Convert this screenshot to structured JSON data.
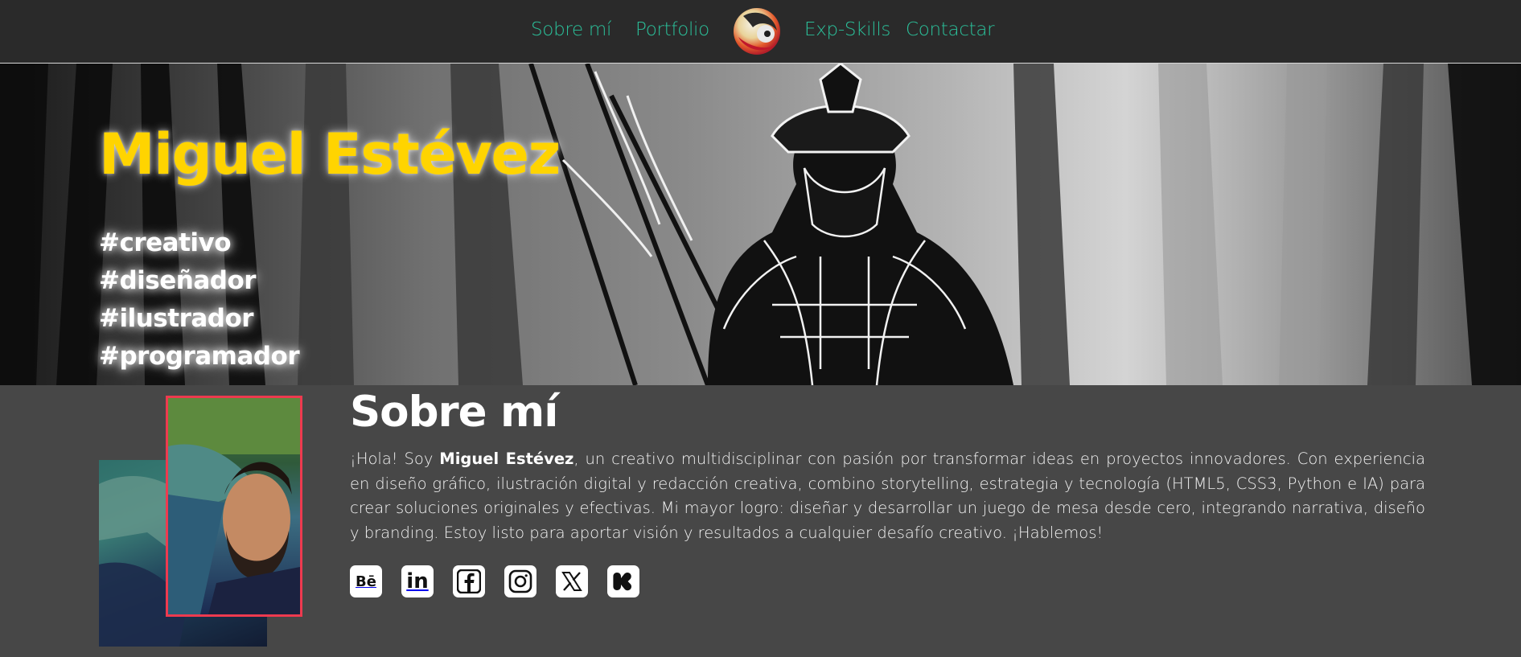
{
  "nav": {
    "items": [
      {
        "label": "Sobre mí"
      },
      {
        "label": "Portfolio"
      },
      {
        "label": "Exp-Skills"
      },
      {
        "label": "Contactar"
      }
    ],
    "logo_icon": "logo-icon"
  },
  "hero": {
    "name": "Miguel Estévez",
    "tags": [
      "#creativo",
      "#diseñador",
      "#ilustrador",
      "#programador"
    ],
    "background_icon": "samurai-illustration"
  },
  "about": {
    "title": "Sobre mí",
    "text_intro": "¡Hola! Soy ",
    "text_name": "Miguel Estévez",
    "text_body": ", un creativo multidisciplinar con pasión por transformar ideas en proyectos innovadores. Con experiencia en diseño gráfico, ilustración digital y redacción creativa, combino storytelling, estrategia y tecnología (HTML5, CSS3, Python e IA) para crear soluciones originales y efectivas. Mi mayor logro: diseñar y desarrollar un juego de mesa desde cero, integrando narrativa, diseño y branding. Estoy listo para aportar visión y resultados a cualquier desafío creativo. ¡Hablemos!",
    "socials": [
      {
        "icon": "behance-icon",
        "glyph": "Bē"
      },
      {
        "icon": "linkedin-icon",
        "glyph": "in"
      },
      {
        "icon": "facebook-icon",
        "glyph": "f"
      },
      {
        "icon": "instagram-icon",
        "glyph": ""
      },
      {
        "icon": "x-icon",
        "glyph": "𝕏"
      },
      {
        "icon": "kickstarter-icon",
        "glyph": "k"
      }
    ]
  },
  "colors": {
    "accent": "#2bc09a",
    "name": "#ffd400",
    "photo_border": "#ee3a4f",
    "nav_bg": "#2a2a2a",
    "page_bg": "#474747"
  }
}
